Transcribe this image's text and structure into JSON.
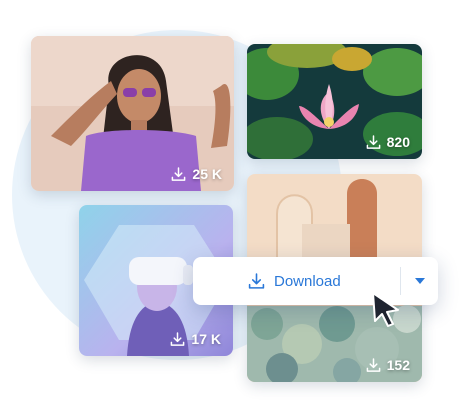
{
  "cards": [
    {
      "id": "portrait",
      "downloads": "25 K"
    },
    {
      "id": "lotus",
      "downloads": "820"
    },
    {
      "id": "vr",
      "downloads": "17 K"
    },
    {
      "id": "arch",
      "downloads": "152"
    }
  ],
  "popover": {
    "label": "Download",
    "icon": "download-icon",
    "menu_icon": "caret-down-icon"
  },
  "colors": {
    "accent": "#2a78d8",
    "background_blob": "#e9f3fb",
    "card_text": "#ffffff"
  }
}
